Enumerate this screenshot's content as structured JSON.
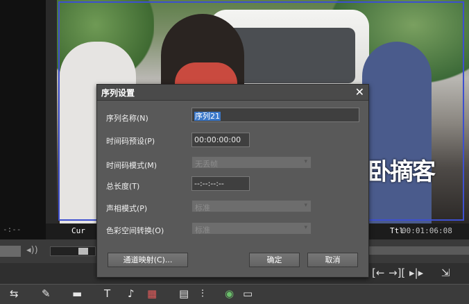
{
  "dialog": {
    "title": "序列设置",
    "close_glyph": "✕",
    "fields": {
      "sequence_name": {
        "label": "序列名称(N)",
        "value": "序列21"
      },
      "timecode_preset": {
        "label": "时间码预设(P)",
        "value": "00:00:00:00"
      },
      "timecode_mode": {
        "label": "时间码模式(M)",
        "value": "无丢帧"
      },
      "total_length": {
        "label": "总长度(T)",
        "value": "--:--:--:--"
      },
      "audio_mode": {
        "label": "声相模式(P)",
        "value": "标准"
      },
      "color_space": {
        "label": "色彩空间转换(O)",
        "value": "标准"
      }
    },
    "buttons": {
      "channel_map": "通道映射(C)...",
      "ok": "确定",
      "cancel": "取消"
    }
  },
  "player": {
    "left_timecode": "-:--",
    "cur_label": "Cur",
    "ttl_label": "Ttl",
    "ttl_value": "00:01:06:08",
    "watermark": "卧摘客"
  },
  "icons": {
    "dropdown": "▾",
    "mark_in": "[←",
    "mark_out": "→][",
    "split": "▸|▸",
    "export": "⇲",
    "audio": "◂))",
    "text": "T",
    "mic": "🎤"
  },
  "colors": {
    "dialog_bg": "#595959",
    "selection": "#3b78c9",
    "safe_frame": "#3d4fd0"
  }
}
